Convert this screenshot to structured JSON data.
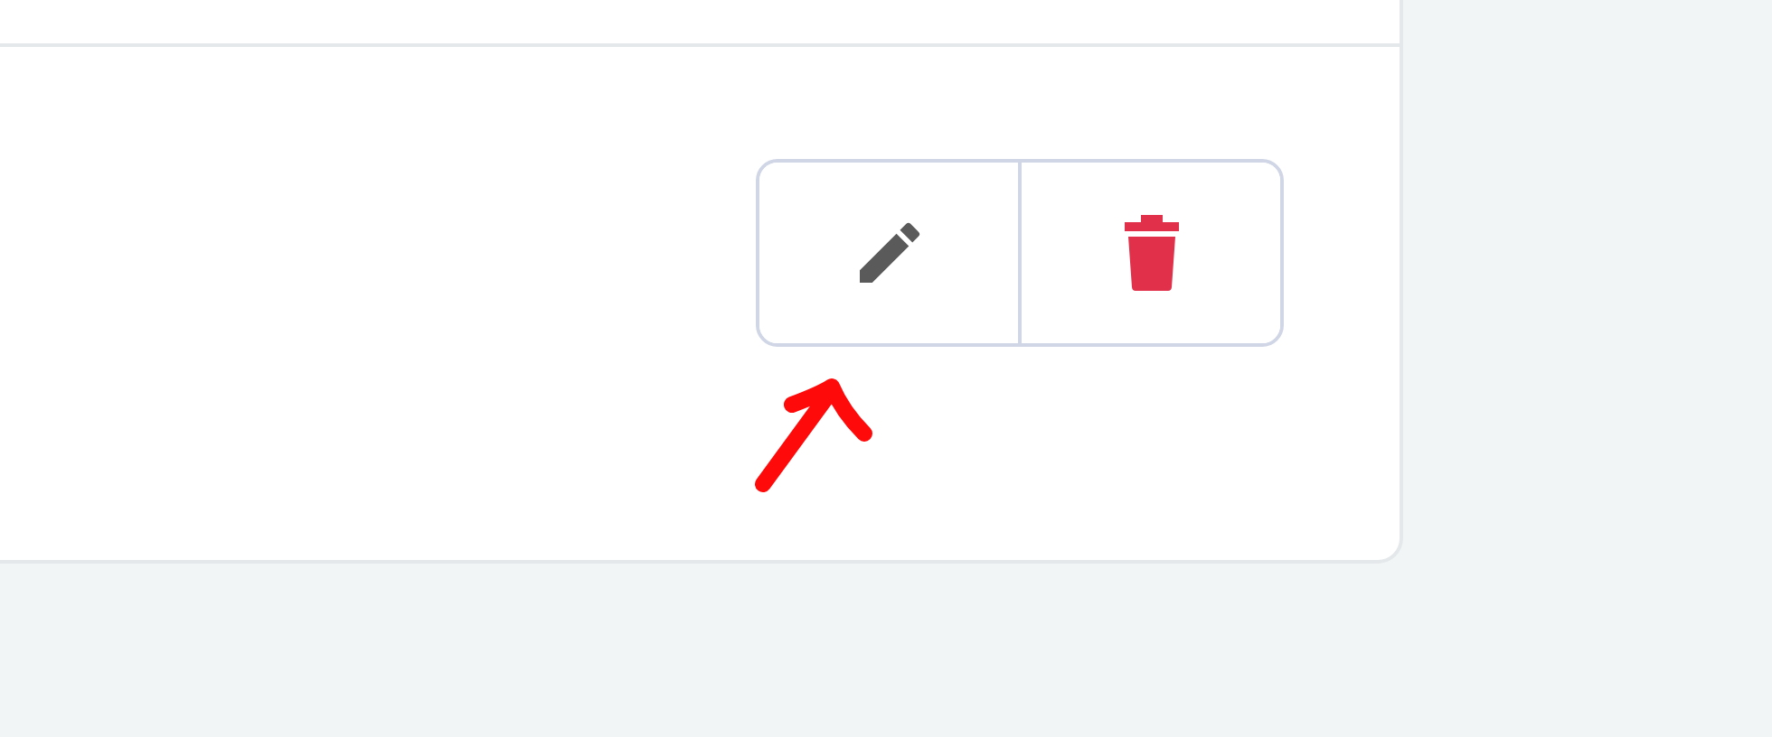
{
  "actions": [
    {
      "kind": "edit"
    },
    {
      "kind": "delete"
    }
  ],
  "annotation": {
    "kind": "arrow"
  }
}
